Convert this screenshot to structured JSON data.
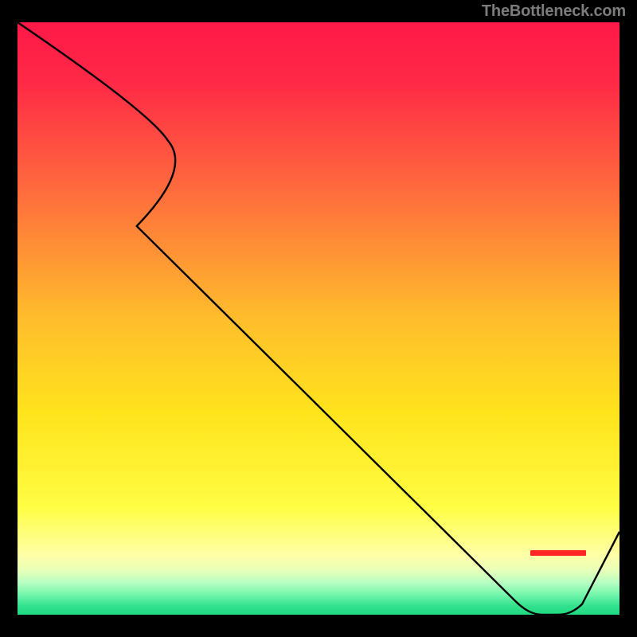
{
  "attribution": "TheBottleneck.com",
  "chart_data": {
    "type": "line",
    "title": "",
    "xlabel": "",
    "ylabel": "",
    "x": [
      0,
      25,
      85,
      92,
      100
    ],
    "values": [
      100,
      80,
      0,
      0,
      14
    ],
    "xlim": [
      0,
      100
    ],
    "ylim": [
      0,
      100
    ],
    "background_gradient_stops": [
      {
        "pos": 0.0,
        "color": "#ff1948"
      },
      {
        "pos": 0.1,
        "color": "#ff2946"
      },
      {
        "pos": 0.28,
        "color": "#ff6a3d"
      },
      {
        "pos": 0.5,
        "color": "#ffbd2c"
      },
      {
        "pos": 0.66,
        "color": "#ffe41c"
      },
      {
        "pos": 0.82,
        "color": "#fffd44"
      },
      {
        "pos": 0.9,
        "color": "#ffffa8"
      },
      {
        "pos": 0.925,
        "color": "#e8ffb8"
      },
      {
        "pos": 0.945,
        "color": "#b9ffc3"
      },
      {
        "pos": 0.965,
        "color": "#79f7ad"
      },
      {
        "pos": 0.985,
        "color": "#34e28e"
      },
      {
        "pos": 1.0,
        "color": "#1ed97f"
      }
    ],
    "annotations": []
  }
}
